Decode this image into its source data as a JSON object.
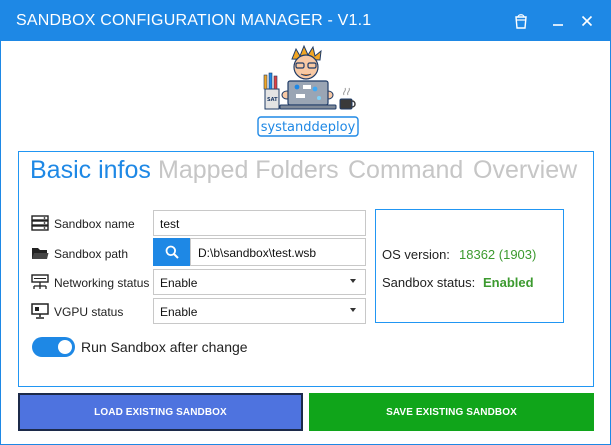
{
  "window": {
    "title": "SANDBOX CONFIGURATION MANAGER - V1.1"
  },
  "logo": {
    "brand_text": "systanddeploy"
  },
  "tabs": [
    {
      "label": "Basic infos",
      "active": true
    },
    {
      "label": "Mapped Folders",
      "active": false
    },
    {
      "label": "Command",
      "active": false
    },
    {
      "label": "Overview",
      "active": false
    }
  ],
  "form": {
    "sandbox_name": {
      "label": "Sandbox name",
      "value": "test",
      "icon": "server-icon"
    },
    "sandbox_path": {
      "label": "Sandbox path",
      "value": "D:\\b\\sandbox\\test.wsb",
      "icon": "folder-icon"
    },
    "networking_status": {
      "label": "Networking status",
      "value": "Enable",
      "icon": "network-icon"
    },
    "vgpu_status": {
      "label": "VGPU status",
      "value": "Enable",
      "icon": "monitor-icon"
    }
  },
  "info": {
    "os_version_label": "OS version:",
    "os_version_value": "18362 (1903)",
    "sandbox_status_label": "Sandbox status:",
    "sandbox_status_value": "Enabled"
  },
  "toggle": {
    "label": "Run Sandbox after change",
    "on": true
  },
  "buttons": {
    "load": "LOAD EXISTING SANDBOX",
    "save": "SAVE EXISTING SANDBOX"
  },
  "colors": {
    "accent": "#1e88e5",
    "success": "#3c9a2f",
    "load_button": "#4e73df",
    "save_button": "#10a51a"
  }
}
